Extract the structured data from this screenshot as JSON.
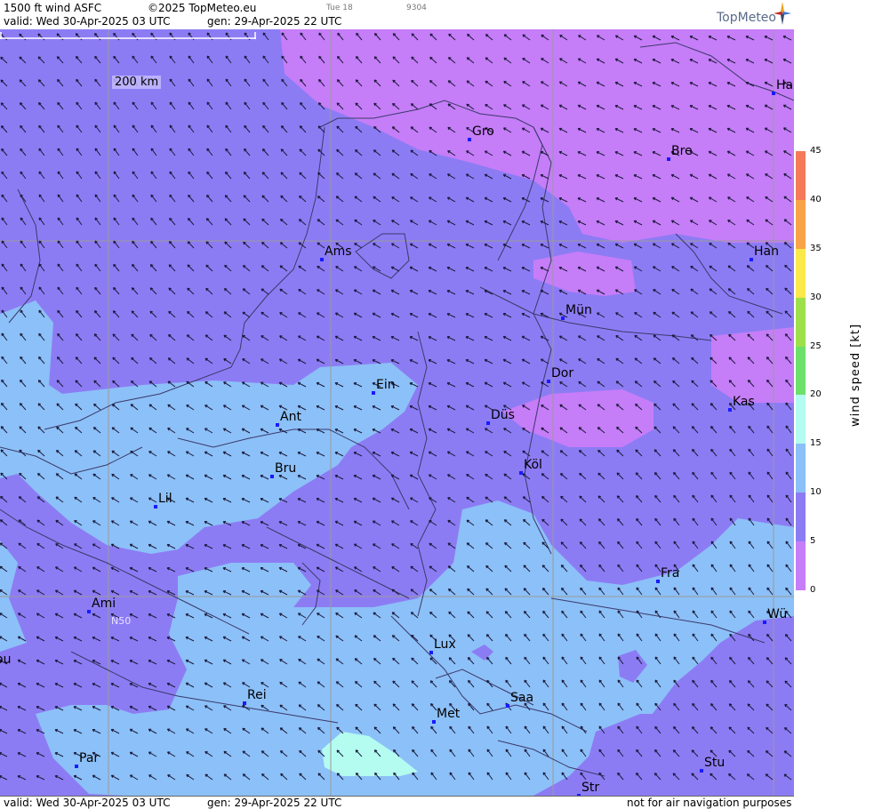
{
  "header": {
    "product": "1500 ft wind ASFC",
    "copyright": "©2025 TopMeteo.eu",
    "valid": "valid:  Wed  30-Apr-2025  03 UTC",
    "gen": "gen: 29-Apr-2025 22 UTC",
    "small_day": "Tue 18",
    "small_code": "9304",
    "logo": "TopMeteo"
  },
  "footer": {
    "valid": "valid:  Wed  30-Apr-2025  03 UTC",
    "gen": "gen: 29-Apr-2025 22 UTC",
    "disclaimer": "not for air navigation purposes"
  },
  "scale_bar": "200 km",
  "grid_label": "N50",
  "cities": [
    {
      "name": "Gro"
    },
    {
      "name": "Bre"
    },
    {
      "name": "Ha"
    },
    {
      "name": "Ams"
    },
    {
      "name": "Han"
    },
    {
      "name": "Mün"
    },
    {
      "name": "Dor"
    },
    {
      "name": "Ein"
    },
    {
      "name": "Düs"
    },
    {
      "name": "Kas"
    },
    {
      "name": "Ant"
    },
    {
      "name": "Bru"
    },
    {
      "name": "Köl"
    },
    {
      "name": "Lil"
    },
    {
      "name": "Fra"
    },
    {
      "name": "Ami"
    },
    {
      "name": "Wü"
    },
    {
      "name": "Lux"
    },
    {
      "name": "ou"
    },
    {
      "name": "Rei"
    },
    {
      "name": "Saa"
    },
    {
      "name": "Met"
    },
    {
      "name": "Par"
    },
    {
      "name": "Stu"
    },
    {
      "name": "Str"
    }
  ],
  "legend": {
    "title": "wind speed  [kt]",
    "ticks": [
      "45",
      "40",
      "35",
      "30",
      "25",
      "20",
      "15",
      "10",
      "5",
      "0"
    ],
    "colors": [
      "#f47a5a",
      "#f9a348",
      "#fbe84a",
      "#9ee04c",
      "#6de06c",
      "#b4fbf0",
      "#8cc0f8",
      "#8c7cf4",
      "#c67df8"
    ]
  }
}
